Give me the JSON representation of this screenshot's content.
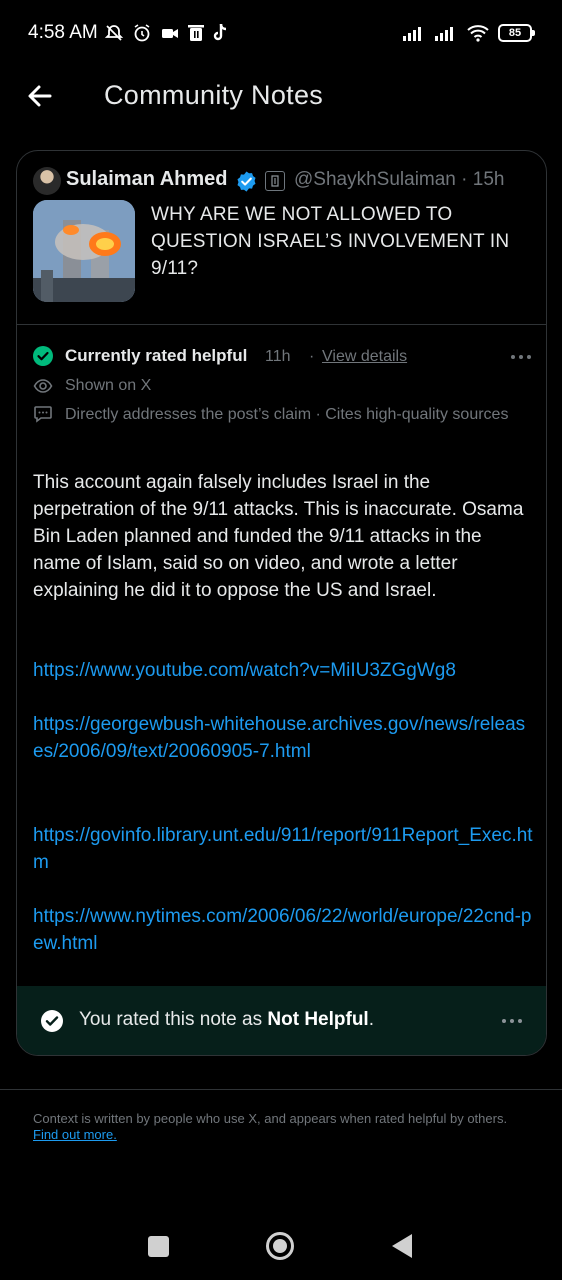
{
  "status_bar": {
    "time": "4:58 AM",
    "battery": "85"
  },
  "header": {
    "title": "Community Notes"
  },
  "post": {
    "author_name": "Sulaiman Ahmed",
    "handle_time": "@ShaykhSulaiman · 15h",
    "text": "WHY ARE WE NOT ALLOWED TO QUESTION ISRAEL’S INVOLVEMENT IN 9/11?"
  },
  "note": {
    "status_label": "Currently rated helpful",
    "age": "11h",
    "separator": "·",
    "view_details_label": "View details",
    "shown_label": "Shown on X",
    "reasons": "Directly addresses the post’s claim · Cites high-quality sources",
    "body": "This account again falsely includes Israel in the perpetration of the 9/11 attacks. This is inaccurate. Osama Bin Laden planned and funded the 9/11 attacks in the name of Islam, said so on video, and wrote a letter explaining he did it to oppose the US and Israel.",
    "links": [
      "https://www.youtube.com/watch?v=MiIU3ZGgWg8",
      "https://georgewbush-whitehouse.archives.gov/news/releases/2006/09/text/20060905-7.html",
      "https://govinfo.library.unt.edu/911/report/911Report_Exec.htm",
      "https://www.nytimes.com/2006/06/22/world/europe/22cnd-pew.html"
    ]
  },
  "rating": {
    "prefix": "You rated this note as ",
    "value": "Not Helpful",
    "suffix": "."
  },
  "footer": {
    "text": "Context is written by people who use X, and appears when rated helpful by others.",
    "link_label": "Find out more."
  },
  "colors": {
    "accent": "#1d9bf0",
    "helpful_green": "#00ba7c",
    "rating_bar_bg": "#061f1a"
  },
  "icons": {
    "back": "arrow-left-icon",
    "verified": "verified-badge-icon",
    "helpful": "check-circle-icon",
    "shown": "eye-icon",
    "reasons": "chat-bubble-icon",
    "more": "more-horizontal-icon"
  }
}
